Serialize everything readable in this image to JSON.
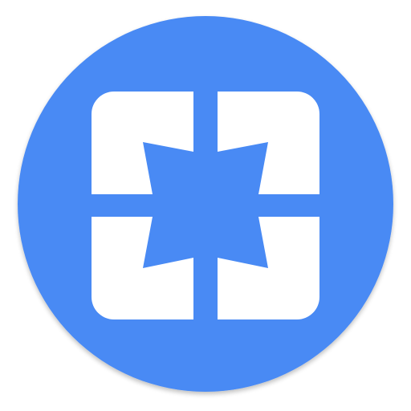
{
  "icon": {
    "name": "gift-box-star-icon",
    "colors": {
      "background_circle": "#4a8af4",
      "shape": "#ffffff",
      "shadow": "#000000"
    }
  }
}
